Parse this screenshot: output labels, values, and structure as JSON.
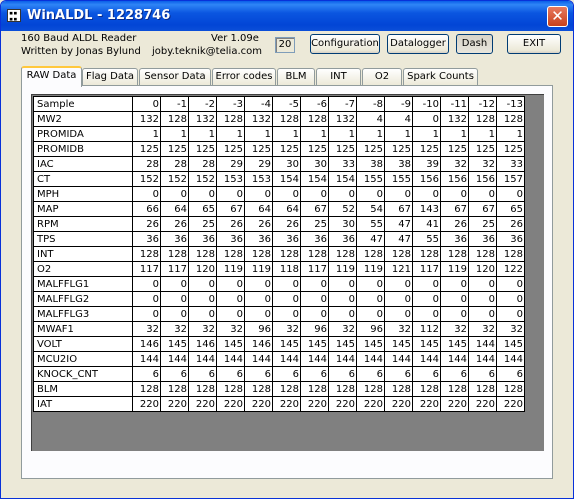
{
  "window": {
    "title": "WinALDL - 1228746",
    "close_glyph": "✕"
  },
  "header": {
    "app_line1": "160 Baud ALDL Reader",
    "app_line2": "Written by Jonas Bylund",
    "version": "Ver 1.09e",
    "email": "joby.teknik@telia.com",
    "counter": "20"
  },
  "toolbar": {
    "configuration": "Configuration",
    "datalogger": "Datalogger",
    "dash": "Dash",
    "exit": "EXIT"
  },
  "tabs": [
    "RAW Data",
    "Flag Data",
    "Sensor Data",
    "Error codes",
    "BLM",
    "INT",
    "O2",
    "Spark Counts"
  ],
  "active_tab": "RAW Data",
  "grid": {
    "columns": [
      "Sample",
      "0",
      "-1",
      "-2",
      "-3",
      "-4",
      "-5",
      "-6",
      "-7",
      "-8",
      "-9",
      "-10",
      "-11",
      "-12",
      "-13"
    ],
    "rows": [
      {
        "label": "MW2",
        "values": [
          "132",
          "128",
          "132",
          "128",
          "132",
          "128",
          "128",
          "132",
          "4",
          "4",
          "0",
          "132",
          "128",
          "128"
        ]
      },
      {
        "label": "PROMIDA",
        "values": [
          "1",
          "1",
          "1",
          "1",
          "1",
          "1",
          "1",
          "1",
          "1",
          "1",
          "1",
          "1",
          "1",
          "1"
        ]
      },
      {
        "label": "PROMIDB",
        "values": [
          "125",
          "125",
          "125",
          "125",
          "125",
          "125",
          "125",
          "125",
          "125",
          "125",
          "125",
          "125",
          "125",
          "125"
        ]
      },
      {
        "label": "IAC",
        "values": [
          "28",
          "28",
          "28",
          "29",
          "29",
          "30",
          "30",
          "33",
          "38",
          "38",
          "39",
          "32",
          "32",
          "33"
        ]
      },
      {
        "label": "CT",
        "values": [
          "152",
          "152",
          "152",
          "153",
          "153",
          "154",
          "154",
          "154",
          "155",
          "155",
          "156",
          "156",
          "156",
          "157"
        ]
      },
      {
        "label": "MPH",
        "values": [
          "0",
          "0",
          "0",
          "0",
          "0",
          "0",
          "0",
          "0",
          "0",
          "0",
          "0",
          "0",
          "0",
          "0"
        ]
      },
      {
        "label": "MAP",
        "values": [
          "66",
          "64",
          "65",
          "67",
          "64",
          "64",
          "67",
          "52",
          "54",
          "67",
          "143",
          "67",
          "67",
          "65"
        ]
      },
      {
        "label": "RPM",
        "values": [
          "26",
          "26",
          "25",
          "26",
          "26",
          "26",
          "25",
          "30",
          "55",
          "47",
          "41",
          "26",
          "25",
          "26"
        ]
      },
      {
        "label": "TPS",
        "values": [
          "36",
          "36",
          "36",
          "36",
          "36",
          "36",
          "36",
          "36",
          "47",
          "47",
          "55",
          "36",
          "36",
          "36"
        ]
      },
      {
        "label": "INT",
        "values": [
          "128",
          "128",
          "128",
          "128",
          "128",
          "128",
          "128",
          "128",
          "128",
          "128",
          "128",
          "128",
          "128",
          "128"
        ]
      },
      {
        "label": "O2",
        "values": [
          "117",
          "117",
          "120",
          "119",
          "119",
          "118",
          "117",
          "119",
          "119",
          "121",
          "117",
          "119",
          "120",
          "122"
        ]
      },
      {
        "label": "MALFFLG1",
        "values": [
          "0",
          "0",
          "0",
          "0",
          "0",
          "0",
          "0",
          "0",
          "0",
          "0",
          "0",
          "0",
          "0",
          "0"
        ]
      },
      {
        "label": "MALFFLG2",
        "values": [
          "0",
          "0",
          "0",
          "0",
          "0",
          "0",
          "0",
          "0",
          "0",
          "0",
          "0",
          "0",
          "0",
          "0"
        ]
      },
      {
        "label": "MALFFLG3",
        "values": [
          "0",
          "0",
          "0",
          "0",
          "0",
          "0",
          "0",
          "0",
          "0",
          "0",
          "0",
          "0",
          "0",
          "0"
        ]
      },
      {
        "label": "MWAF1",
        "values": [
          "32",
          "32",
          "32",
          "32",
          "96",
          "32",
          "96",
          "32",
          "96",
          "32",
          "112",
          "32",
          "32",
          "32"
        ]
      },
      {
        "label": "VOLT",
        "values": [
          "146",
          "145",
          "146",
          "145",
          "146",
          "145",
          "145",
          "145",
          "145",
          "145",
          "145",
          "145",
          "144",
          "145"
        ]
      },
      {
        "label": "MCU2IO",
        "values": [
          "144",
          "144",
          "144",
          "144",
          "144",
          "144",
          "144",
          "144",
          "144",
          "144",
          "144",
          "144",
          "144",
          "144"
        ]
      },
      {
        "label": "KNOCK_CNT",
        "values": [
          "6",
          "6",
          "6",
          "6",
          "6",
          "6",
          "6",
          "6",
          "6",
          "6",
          "6",
          "6",
          "6",
          "6"
        ]
      },
      {
        "label": "BLM",
        "values": [
          "128",
          "128",
          "128",
          "128",
          "128",
          "128",
          "128",
          "128",
          "128",
          "128",
          "128",
          "128",
          "128",
          "128"
        ]
      },
      {
        "label": "IAT",
        "values": [
          "220",
          "220",
          "220",
          "220",
          "220",
          "220",
          "220",
          "220",
          "220",
          "220",
          "220",
          "220",
          "220",
          "220"
        ]
      }
    ]
  }
}
